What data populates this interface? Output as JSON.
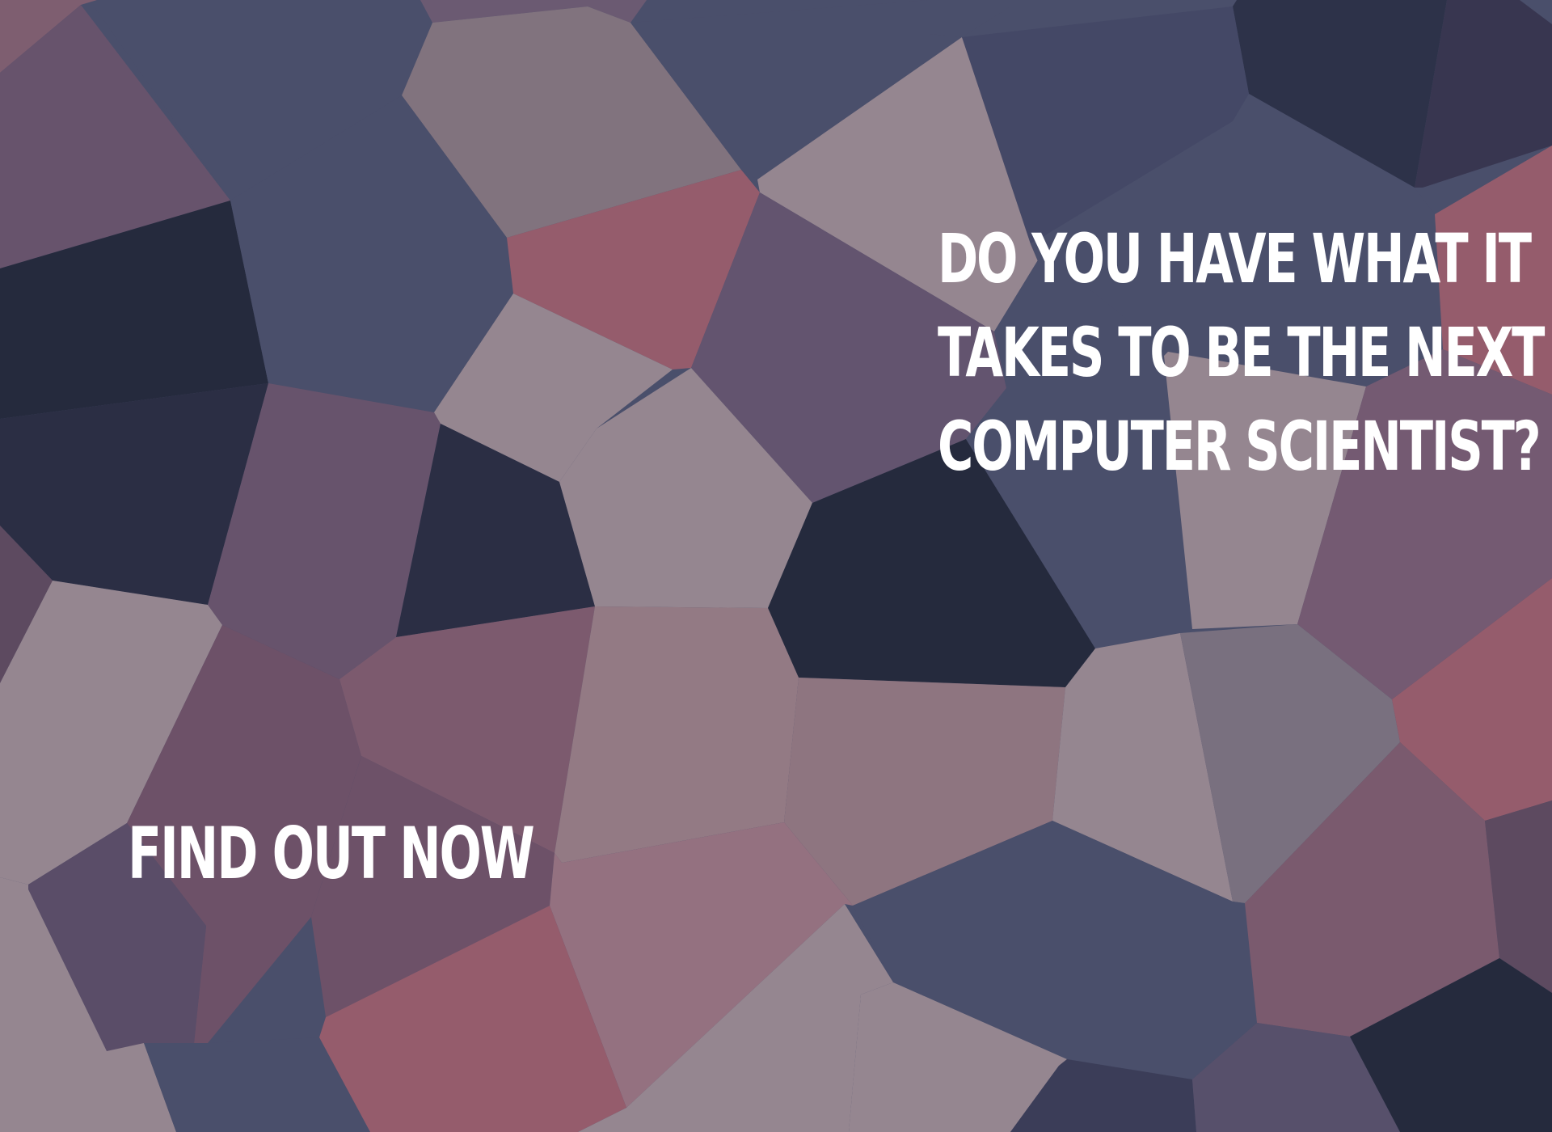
{
  "headline": {
    "line1": "DO YOU HAVE WHAT IT",
    "line2": "TAKES TO BE THE NEXT",
    "line3": "COMPUTER SCIENTIST?"
  },
  "cta": {
    "label": "FIND OUT NOW"
  },
  "colors": {
    "text": "#ffffff",
    "palette": [
      "#4a4f6b",
      "#8e7a82",
      "#955c6c",
      "#6a526a",
      "#252a3d",
      "#958690",
      "#7c5a6e"
    ]
  }
}
